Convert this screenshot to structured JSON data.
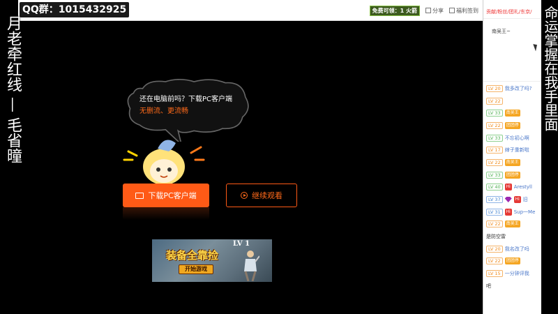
{
  "overlay": {
    "left_text": "月老牵红线 — 毛省曈",
    "right_text": "命运掌握在我手里面"
  },
  "toolbar": {
    "qq_label": "QQ群：1015432925",
    "badge": "免费可领：1 火箭",
    "share": "分享",
    "welfare": "福利签到"
  },
  "player": {
    "bubble_line1": "还在电脑前吗？下载PC客户端",
    "bubble_line2": "无删流、更流畅",
    "download_button": "下载PC客户端",
    "continue_button": "继续观看"
  },
  "ad": {
    "title": "装备全靠捡",
    "level": "LV 1",
    "start": "开始游戏"
  },
  "sidebar": {
    "tabs": "贡献/粉丝/团礼/东京/",
    "note": "南吴王~",
    "chat": [
      {
        "lv": "LV 20",
        "lvc": "o",
        "badge": "",
        "hi": false,
        "gem": false,
        "text": "我多改了吗?",
        "dark": false
      },
      {
        "lv": "LV 22",
        "lvc": "o",
        "badge": "",
        "hi": false,
        "gem": false,
        "text": "",
        "dark": false
      },
      {
        "lv": "LV 33",
        "lvc": "g",
        "badge": "南吴王",
        "hi": false,
        "gem": false,
        "text": "",
        "dark": false
      },
      {
        "lv": "LV 22",
        "lvc": "o",
        "badge": "团团停",
        "hi": false,
        "gem": false,
        "text": "",
        "dark": false
      },
      {
        "lv": "LV 33",
        "lvc": "g",
        "badge": "",
        "hi": false,
        "gem": false,
        "text": "不忘初心啊",
        "dark": false
      },
      {
        "lv": "LV 17",
        "lvc": "o",
        "badge": "",
        "hi": false,
        "gem": false,
        "text": "婶子重新啦",
        "dark": false
      },
      {
        "lv": "LV 22",
        "lvc": "o",
        "badge": "南吴王",
        "hi": false,
        "gem": false,
        "text": "",
        "dark": false
      },
      {
        "lv": "LV 33",
        "lvc": "g",
        "badge": "团团停",
        "hi": false,
        "gem": false,
        "text": "",
        "dark": false
      },
      {
        "lv": "LV 40",
        "lvc": "g",
        "badge": "",
        "hi": true,
        "gem": false,
        "text": "Arestyll",
        "dark": false
      },
      {
        "lv": "LV 37",
        "lvc": "b",
        "badge": "",
        "hi": true,
        "gem": true,
        "text": "旧",
        "dark": false
      },
      {
        "lv": "LV 31",
        "lvc": "b",
        "badge": "",
        "hi": true,
        "gem": false,
        "text": "Sup一Me",
        "dark": false
      },
      {
        "lv": "LV 22",
        "lvc": "o",
        "badge": "南吴王",
        "hi": false,
        "gem": false,
        "text": "",
        "dark": false
      },
      {
        "lv": "",
        "lvc": "o",
        "badge": "",
        "hi": false,
        "gem": false,
        "text": "是防空雷",
        "dark": true
      },
      {
        "lv": "LV 20",
        "lvc": "o",
        "badge": "",
        "hi": false,
        "gem": false,
        "text": "我名改了吗",
        "dark": false
      },
      {
        "lv": "LV 22",
        "lvc": "o",
        "badge": "团团停",
        "hi": false,
        "gem": false,
        "text": "",
        "dark": false
      },
      {
        "lv": "LV 15",
        "lvc": "o",
        "badge": "",
        "hi": false,
        "gem": false,
        "text": "一分钟评我",
        "dark": false
      },
      {
        "lv": "",
        "lvc": "o",
        "badge": "",
        "hi": false,
        "gem": false,
        "text": "吧",
        "dark": true
      }
    ]
  }
}
